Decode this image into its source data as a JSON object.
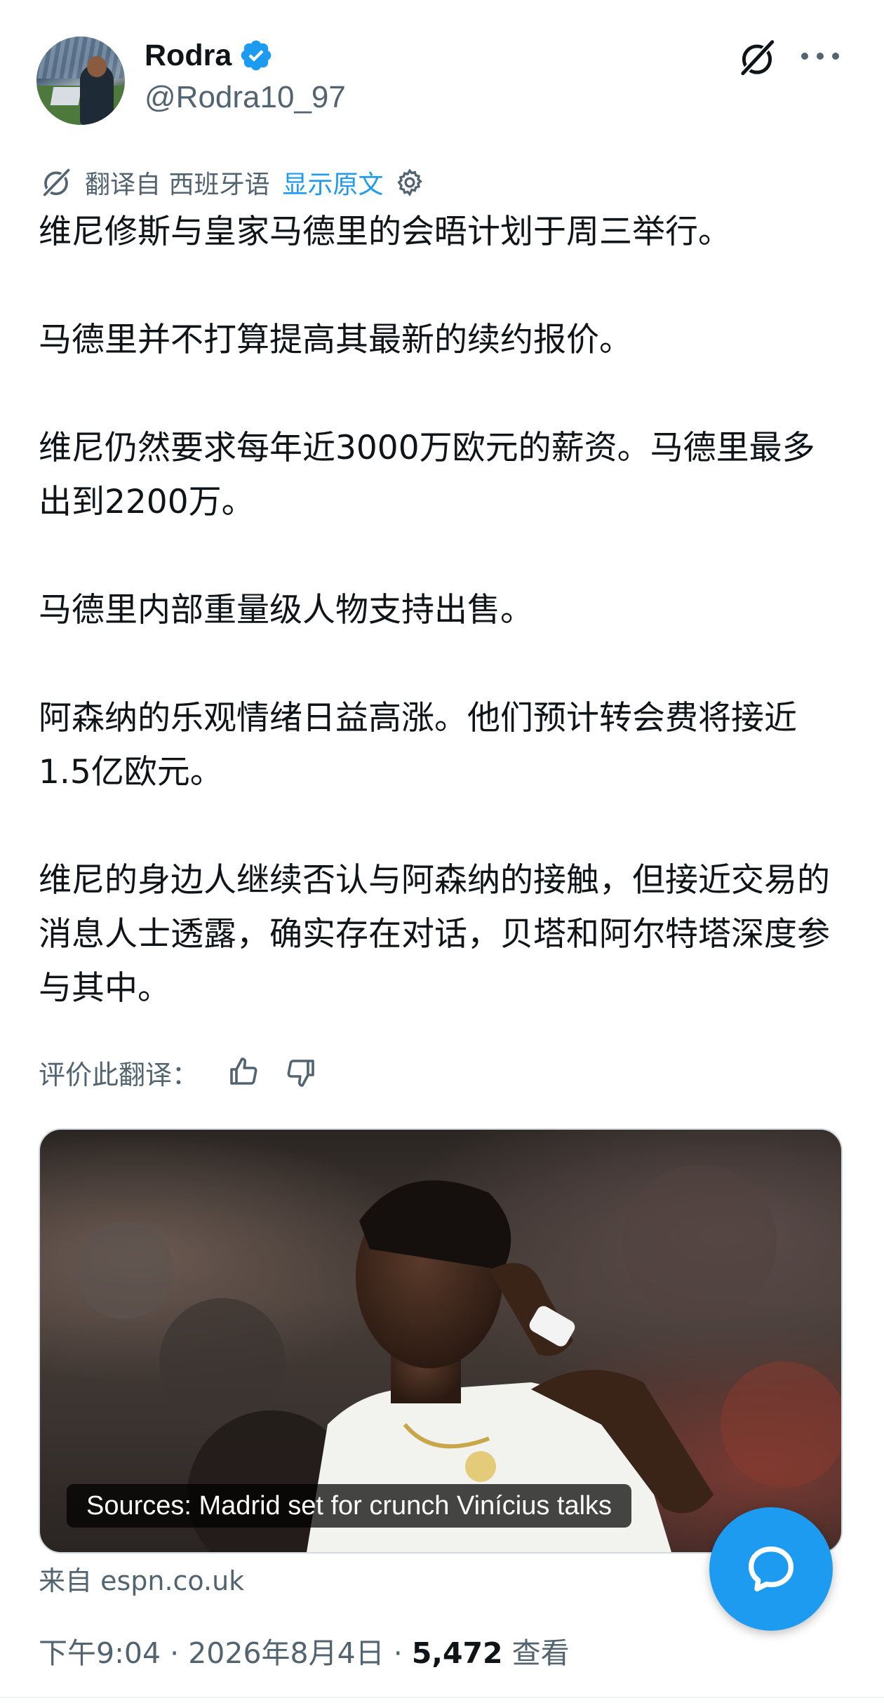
{
  "author": {
    "display_name": "Rodra",
    "handle": "@Rodra10_97",
    "verified": true,
    "verified_color": "#1d9bf0"
  },
  "header_actions": {
    "grok_icon": "grok-icon",
    "more_icon": "more-icon"
  },
  "translation": {
    "label": "翻译自 西班牙语",
    "show_original": "显示原文",
    "settings_icon": "gear-icon",
    "rate_label": "评价此翻译："
  },
  "tweet": {
    "paragraphs": [
      "维尼修斯与皇家马德里的会晤计划于周三举行。",
      "马德里并不打算提高其最新的续约报价。",
      "维尼仍然要求每年近3000万欧元的薪资。马德里最多出到2200万。",
      "马德里内部重量级人物支持出售。",
      "阿森纳的乐观情绪日益高涨。他们预计转会费将接近1.5亿欧元。",
      "维尼的身边人继续否认与阿森纳的接触，但接近交易的消息人士透露，确实存在对话，贝塔和阿尔特塔深度参与其中。"
    ]
  },
  "card": {
    "caption": "Sources: Madrid set for crunch Vinícius talks",
    "source": "来自 espn.co.uk"
  },
  "meta": {
    "time": "下午9:04",
    "date": "2026年8月4日",
    "views_count": "5,472",
    "views_label": "查看"
  },
  "fab": {
    "icon": "chat-bubble-icon",
    "color": "#1d9bf0"
  }
}
